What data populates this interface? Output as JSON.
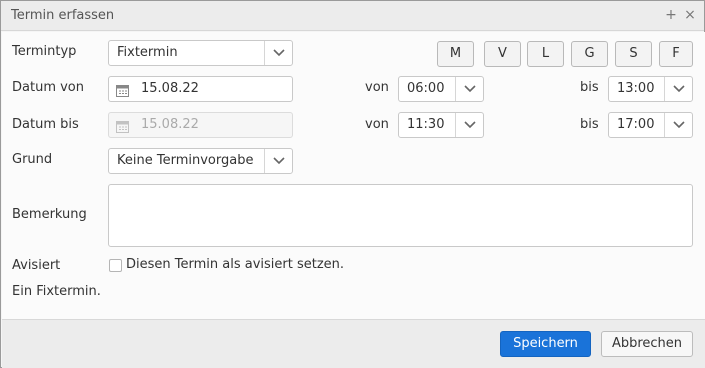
{
  "dialog": {
    "title": "Termin erfassen",
    "icons": {
      "add": "+",
      "close": "×"
    }
  },
  "form": {
    "termintyp": {
      "label": "Termintyp",
      "value": "Fixtermin"
    },
    "day_buttons": [
      "M",
      "V",
      "L",
      "G",
      "S",
      "F"
    ],
    "datum_von": {
      "label": "Datum von",
      "value": "15.08.22",
      "von_label": "von",
      "von_value": "06:00",
      "bis_label": "bis",
      "bis_value": "13:00"
    },
    "datum_bis": {
      "label": "Datum bis",
      "value": "15.08.22",
      "von_label": "von",
      "von_value": "11:30",
      "bis_label": "bis",
      "bis_value": "17:00"
    },
    "grund": {
      "label": "Grund",
      "value": "Keine Terminvorgabe"
    },
    "bemerkung": {
      "label": "Bemerkung",
      "value": ""
    },
    "avisiert": {
      "label": "Avisiert",
      "checkbox_label": "Diesen Termin als avisiert setzen.",
      "checked": false
    },
    "info": "Ein Fixtermin."
  },
  "footer": {
    "save_label": "Speichern",
    "cancel_label": "Abbrechen"
  },
  "colors": {
    "primary": "#1a73d9"
  }
}
